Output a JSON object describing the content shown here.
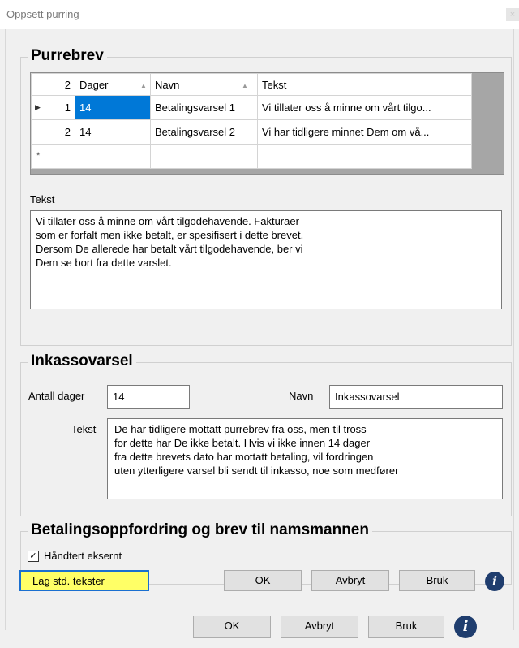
{
  "window": {
    "title": "Oppsett purring",
    "close_glyph": "×"
  },
  "purrebrev": {
    "group_title": "Purrebrev",
    "grid": {
      "header_rownum": "2",
      "columns": [
        "Dager",
        "Navn",
        "Tekst"
      ],
      "rows": [
        {
          "num": "1",
          "dager": "14",
          "navn": "Betalingsvarsel 1",
          "tekst": "Vi tillater oss å minne om vårt tilgo..."
        },
        {
          "num": "2",
          "dager": "14",
          "navn": "Betalingsvarsel 2",
          "tekst": "Vi har tidligere minnet Dem om vå..."
        }
      ],
      "new_row_marker": "*",
      "current_row_marker": "▶",
      "sort_glyph": "▲"
    },
    "tekst_label": "Tekst",
    "tekst_value": "Vi tillater oss å minne om vårt tilgodehavende. Fakturaer\nsom er forfalt men ikke betalt, er spesifisert i dette brevet.\nDersom De allerede har betalt vårt tilgodehavende, ber vi\nDem se bort fra dette varslet."
  },
  "inkassovarsel": {
    "group_title": "Inkassovarsel",
    "antall_dager_label": "Antall dager",
    "antall_dager_value": "14",
    "navn_label": "Navn",
    "navn_value": "Inkassovarsel",
    "tekst_label": "Tekst",
    "tekst_value": "De har tidligere mottatt purrebrev fra oss, men til tross\nfor dette har De ikke betalt. Hvis vi ikke innen 14 dager\nfra dette brevets dato har mottatt betaling, vil fordringen\nuten ytterligere varsel bli sendt til inkasso, noe som medfører"
  },
  "betalingsoppfordring": {
    "group_title": "Betalingsoppfordring og brev til namsmannen",
    "checkbox_label": "Håndtert eksernt",
    "checked": true,
    "check_glyph": "✓"
  },
  "buttons": {
    "std_tekster": "Lag std. tekster",
    "ok": "OK",
    "avbryt": "Avbryt",
    "bruk": "Bruk",
    "info_glyph": "i"
  },
  "outer_buttons": {
    "ok": "OK",
    "avbryt": "Avbryt",
    "bruk": "Bruk",
    "info_glyph": "i"
  },
  "colors": {
    "selection": "#0078d7",
    "highlight": "#ffff66",
    "info_icon": "#1f3d6e"
  }
}
